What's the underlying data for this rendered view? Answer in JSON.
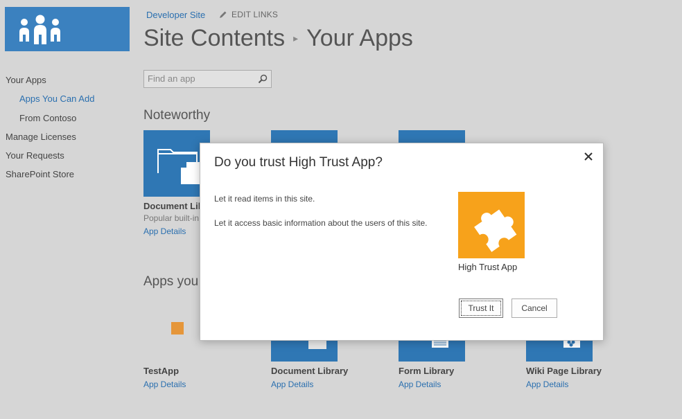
{
  "header": {
    "site_link": "Developer Site",
    "edit_links": "EDIT LINKS",
    "title_part1": "Site Contents",
    "title_part2": "Your Apps"
  },
  "sidebar": {
    "items": [
      {
        "label": "Your Apps"
      },
      {
        "label": "Apps You Can Add"
      },
      {
        "label": "From Contoso"
      },
      {
        "label": "Manage Licenses"
      },
      {
        "label": "Your Requests"
      },
      {
        "label": "SharePoint Store"
      }
    ]
  },
  "search": {
    "placeholder": "Find an app"
  },
  "noteworthy": {
    "heading": "Noteworthy",
    "first_tile": {
      "name": "Document Lib",
      "desc": "Popular built-in",
      "link": "App Details"
    }
  },
  "apps_section": {
    "heading": "Apps you",
    "tiles": [
      {
        "name": "TestApp",
        "link": "App Details"
      },
      {
        "name": "Document Library",
        "link": "App Details"
      },
      {
        "name": "Form Library",
        "link": "App Details"
      },
      {
        "name": "Wiki Page Library",
        "link": "App Details"
      }
    ]
  },
  "dialog": {
    "title": "Do you trust High Trust App?",
    "permission1": "Let it read items in this site.",
    "permission2": "Let it access basic information about the users of this site.",
    "app_name": "High Trust App",
    "trust_button": "Trust It",
    "cancel_button": "Cancel",
    "icon_color": "#f7a21b"
  },
  "colors": {
    "accent": "#2a6faf",
    "tile_blue": "#2f77b4",
    "overlay_gray": "#d6d6d6"
  }
}
